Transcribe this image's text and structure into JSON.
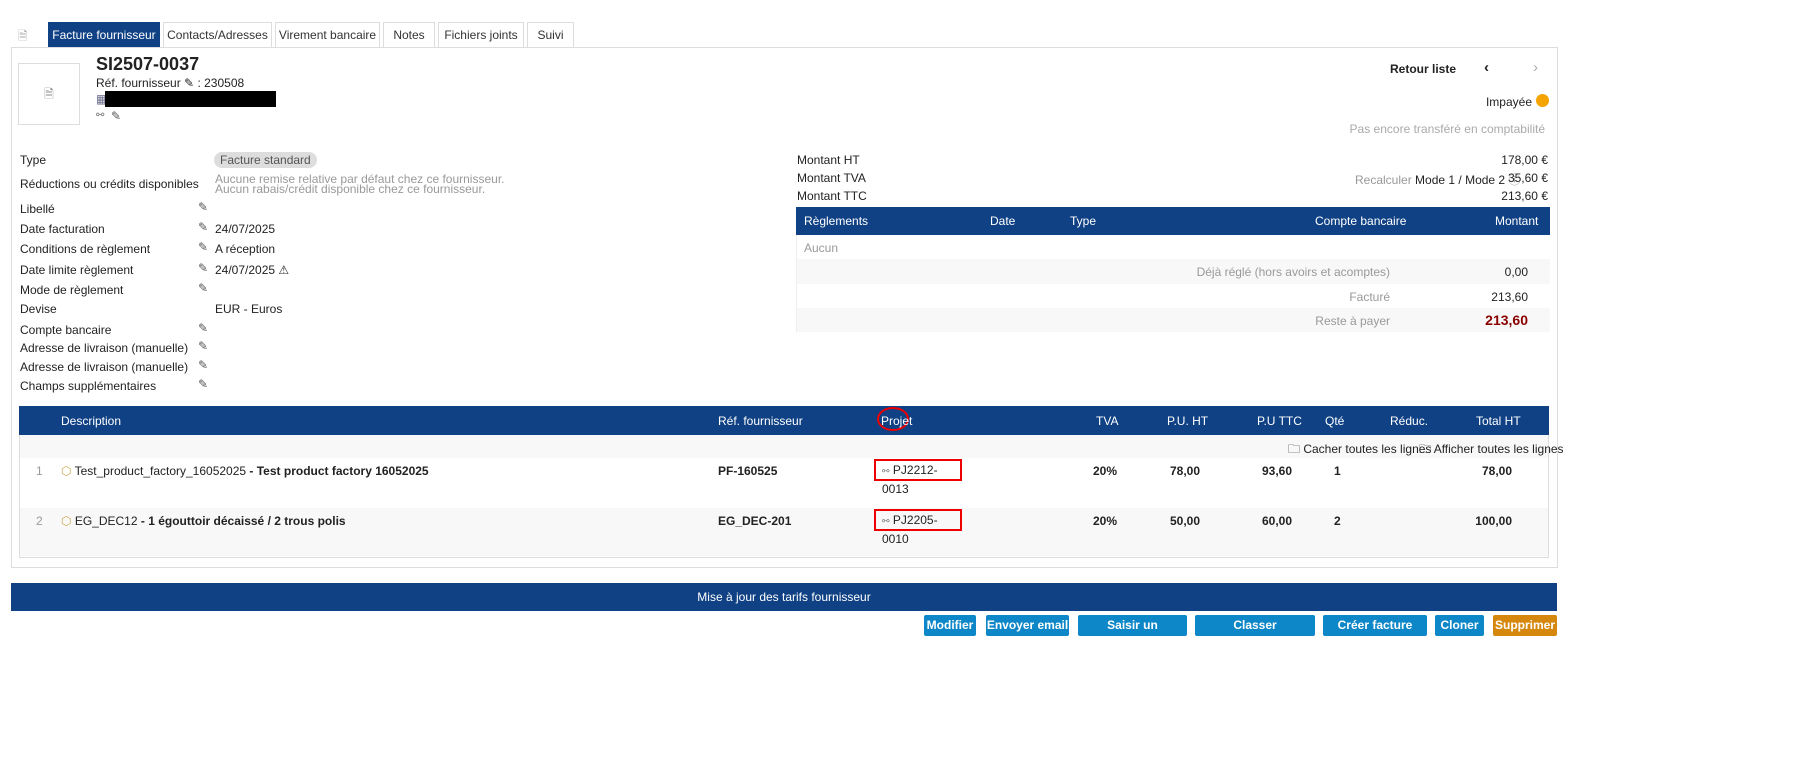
{
  "tabs": [
    "Facture fournisseur",
    "Contacts/Adresses",
    "Virement bancaire",
    "Notes",
    "Fichiers joints",
    "Suivi"
  ],
  "header": {
    "ref": "SI2507-0037",
    "supplier_ref_label": "Réf. fournisseur",
    "supplier_ref": ": 230508",
    "back": "Retour liste",
    "status": "Impayée",
    "accounting": "Pas encore transféré en comptabilité"
  },
  "fields": [
    {
      "label": "Type",
      "value": "Facture standard"
    },
    {
      "label": "Réductions ou crédits disponibles",
      "value": "Aucune remise relative par défaut chez ce fournisseur.",
      "value2": "Aucun rabais/crédit disponible chez ce fournisseur."
    },
    {
      "label": "Libellé",
      "value": ""
    },
    {
      "label": "Date facturation",
      "value": "24/07/2025"
    },
    {
      "label": "Conditions de règlement",
      "value": "A réception"
    },
    {
      "label": "Date limite règlement",
      "value": "24/07/2025 ⚠"
    },
    {
      "label": "Mode de règlement",
      "value": ""
    },
    {
      "label": "Devise",
      "value": "EUR - Euros"
    },
    {
      "label": "Compte bancaire",
      "value": ""
    },
    {
      "label": "Adresse de livraison (manuelle)",
      "value": ""
    },
    {
      "label": "Adresse de livraison (manuelle)",
      "value": ""
    },
    {
      "label": "Champs supplémentaires",
      "value": ""
    }
  ],
  "amounts": {
    "ht_label": "Montant HT",
    "ht": "178,00 €",
    "tva_label": "Montant TVA",
    "recalc": "Recalculer",
    "mode": "Mode 1 / Mode 2",
    "tva": "35,60 €",
    "ttc_label": "Montant TTC",
    "ttc": "213,60 €"
  },
  "payments": {
    "headers": [
      "Règlements",
      "Date",
      "Type",
      "Compte bancaire",
      "Montant"
    ],
    "none": "Aucun",
    "paid_label": "Déjà réglé (hors avoirs et acomptes)",
    "paid": "0,00",
    "billed_label": "Facturé",
    "billed": "213,60",
    "remain_label": "Reste à payer",
    "remain": "213,60"
  },
  "lines": {
    "headers": [
      "Description",
      "Réf. fournisseur",
      "Projet",
      "TVA",
      "P.U. HT",
      "P.U TTC",
      "Qté",
      "Réduc.",
      "Total HT"
    ],
    "hide_all": "Cacher toutes les lignes",
    "show_all": "Afficher toutes les lignes",
    "rows": [
      {
        "num": "1",
        "code": "Test_product_factory_16052025",
        "label": " - Test product factory 16052025",
        "ref": "PF-160525",
        "project": "PJ2212-0013",
        "tva": "20%",
        "pu_ht": "78,00",
        "pu_ttc": "93,60",
        "qty": "1",
        "total": "78,00"
      },
      {
        "num": "2",
        "code": "EG_DEC12",
        "label": " - 1 égouttoir décaissé / 2 trous polis",
        "ref": "EG_DEC-201",
        "project": "PJ2205-0010",
        "tva": "20%",
        "pu_ht": "50,00",
        "pu_ttc": "60,00",
        "qty": "2",
        "total": "100,00"
      }
    ]
  },
  "update_bar": "Mise à jour des tarifs fournisseur",
  "buttons": [
    "Modifier",
    "Envoyer email",
    "Saisir un règlement",
    "Classer 'Abandonnée'",
    "Créer facture avoir",
    "Cloner",
    "Supprimer"
  ]
}
